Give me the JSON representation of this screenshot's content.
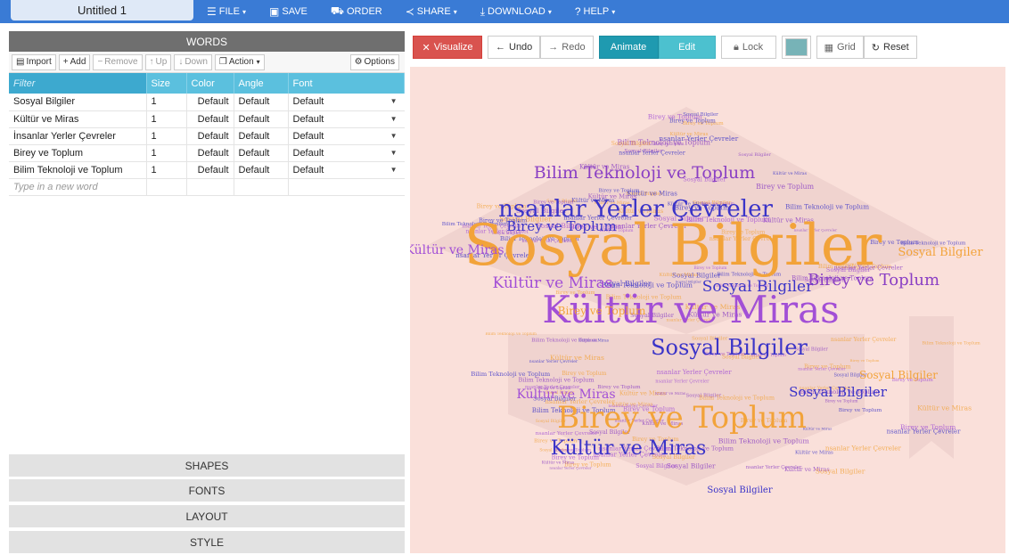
{
  "document": {
    "title": "Untitled 1"
  },
  "menu": [
    {
      "glyph": "☰",
      "icon": "menu-icon",
      "label": "FILE",
      "caret": true
    },
    {
      "glyph": "▣",
      "icon": "save-icon",
      "label": "SAVE",
      "caret": false
    },
    {
      "glyph": "⛟",
      "icon": "cart-icon",
      "label": "ORDER",
      "caret": false
    },
    {
      "glyph": "≺",
      "icon": "share-icon",
      "label": "SHARE",
      "caret": true
    },
    {
      "glyph": "⤓",
      "icon": "download-icon",
      "label": "DOWNLOAD",
      "caret": true
    },
    {
      "glyph": "?",
      "icon": "help-icon",
      "label": "HELP",
      "caret": true
    }
  ],
  "words_panel": {
    "header": "WORDS",
    "toolbar": {
      "import": "Import",
      "add": "Add",
      "remove": "Remove",
      "up": "Up",
      "down": "Down",
      "action": "Action",
      "options": "Options"
    },
    "columns": {
      "filter": "Filter",
      "size": "Size",
      "color": "Color",
      "angle": "Angle",
      "font": "Font"
    },
    "rows": [
      {
        "word": "Sosyal Bilgiler",
        "size": "1",
        "color": "Default",
        "angle": "Default",
        "font": "Default"
      },
      {
        "word": "Kültür ve Miras",
        "size": "1",
        "color": "Default",
        "angle": "Default",
        "font": "Default"
      },
      {
        "word": "İnsanlar Yerler Çevreler",
        "size": "1",
        "color": "Default",
        "angle": "Default",
        "font": "Default"
      },
      {
        "word": "Birey ve Toplum",
        "size": "1",
        "color": "Default",
        "angle": "Default",
        "font": "Default"
      },
      {
        "word": "Bilim Teknoloji ve Toplum",
        "size": "1",
        "color": "Default",
        "angle": "Default",
        "font": "Default"
      }
    ],
    "new_word_placeholder": "Type in a new word"
  },
  "accordion": [
    "SHAPES",
    "FONTS",
    "LAYOUT",
    "STYLE"
  ],
  "canvas_toolbar": {
    "visualize": "Visualize",
    "undo": "Undo",
    "redo": "Redo",
    "animate": "Animate",
    "edit": "Edit",
    "lock": "Lock",
    "grid": "Grid",
    "reset": "Reset",
    "swatch_color": "#77b3b7"
  },
  "cloud": {
    "background": "#fae0da",
    "shape_color": "#f0d3cf",
    "palette": {
      "orange": "#f2a33a",
      "purple": "#8a3fc4",
      "blue": "#3b34c8",
      "violet": "#a24fd6"
    },
    "large_words": [
      {
        "text": "Sosyal Bilgiler",
        "color": "orange"
      },
      {
        "text": "Kültür ve Miras",
        "color": "violet"
      },
      {
        "text": "Birey ve Toplum",
        "color": "orange"
      },
      {
        "text": "nsanlar Yerler Çevreler",
        "color": "blue"
      },
      {
        "text": "Bilim Teknoloji ve Toplum",
        "color": "purple"
      },
      {
        "text": "Sosyal Bilgiler",
        "color": "blue"
      },
      {
        "text": "Sosyal Bilgiler",
        "color": "blue"
      },
      {
        "text": "Kültür ve Miras",
        "color": "violet"
      },
      {
        "text": "Birey ve Toplum",
        "color": "purple"
      },
      {
        "text": "Kültür ve Miras",
        "color": "violet"
      },
      {
        "text": "Birey ve Toplum",
        "color": "blue"
      },
      {
        "text": "Sosyal Bilgiler",
        "color": "blue"
      },
      {
        "text": "Kültür ve Miras",
        "color": "blue"
      },
      {
        "text": "Sosyal Bilgiler",
        "color": "blue"
      },
      {
        "text": "Sosyal Bilgiler",
        "color": "orange"
      },
      {
        "text": "Birey ve Toplum",
        "color": "orange"
      },
      {
        "text": "Kültür ve Miras",
        "color": "violet"
      },
      {
        "text": "Sosyal Bilgiler",
        "color": "orange"
      }
    ]
  }
}
